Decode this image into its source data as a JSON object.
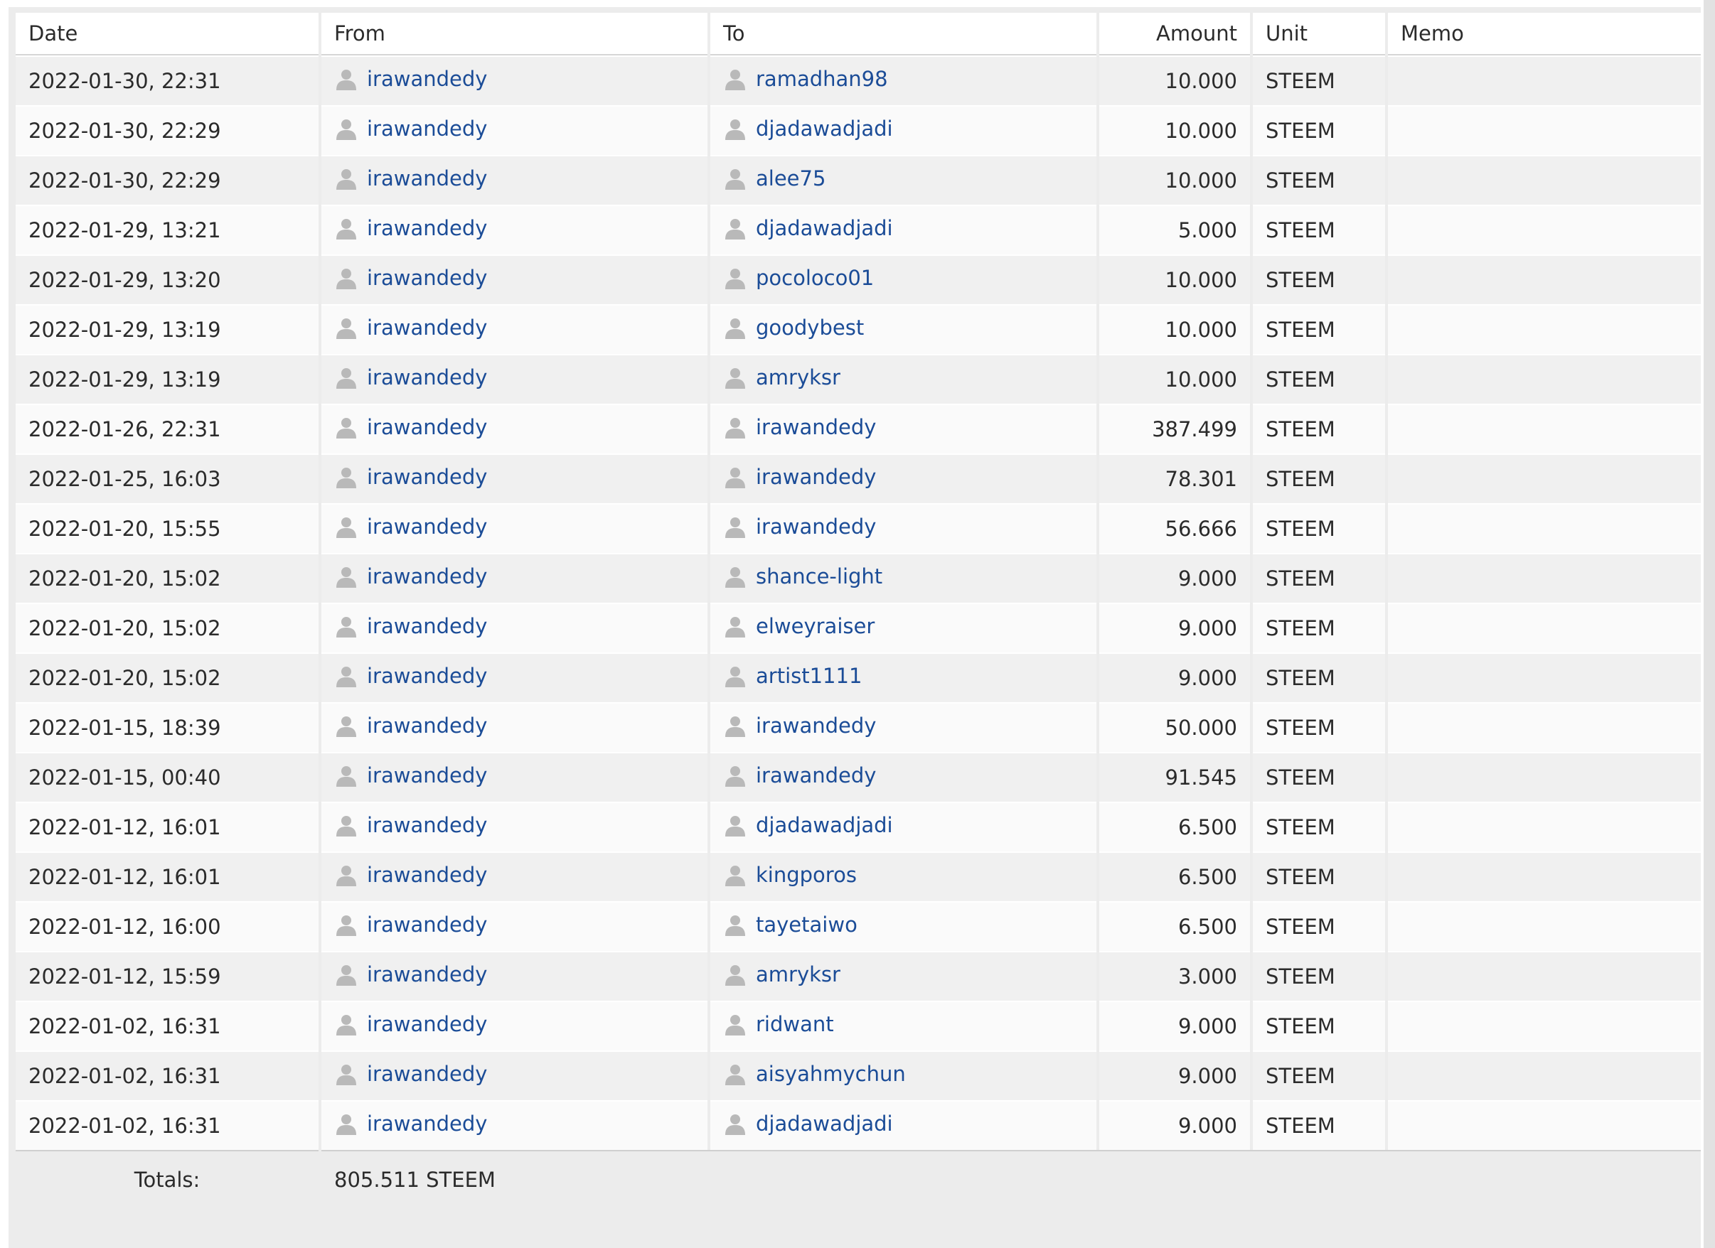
{
  "table": {
    "headers": {
      "date": "Date",
      "from": "From",
      "to": "To",
      "amount": "Amount",
      "unit": "Unit",
      "memo": "Memo"
    },
    "rows": [
      {
        "date": "2022-01-30, 22:31",
        "from": "irawandedy",
        "to": "ramadhan98",
        "amount": "10.000",
        "unit": "STEEM",
        "memo": ""
      },
      {
        "date": "2022-01-30, 22:29",
        "from": "irawandedy",
        "to": "djadawadjadi",
        "amount": "10.000",
        "unit": "STEEM",
        "memo": ""
      },
      {
        "date": "2022-01-30, 22:29",
        "from": "irawandedy",
        "to": "alee75",
        "amount": "10.000",
        "unit": "STEEM",
        "memo": ""
      },
      {
        "date": "2022-01-29, 13:21",
        "from": "irawandedy",
        "to": "djadawadjadi",
        "amount": "5.000",
        "unit": "STEEM",
        "memo": ""
      },
      {
        "date": "2022-01-29, 13:20",
        "from": "irawandedy",
        "to": "pocoloco01",
        "amount": "10.000",
        "unit": "STEEM",
        "memo": ""
      },
      {
        "date": "2022-01-29, 13:19",
        "from": "irawandedy",
        "to": "goodybest",
        "amount": "10.000",
        "unit": "STEEM",
        "memo": ""
      },
      {
        "date": "2022-01-29, 13:19",
        "from": "irawandedy",
        "to": "amryksr",
        "amount": "10.000",
        "unit": "STEEM",
        "memo": ""
      },
      {
        "date": "2022-01-26, 22:31",
        "from": "irawandedy",
        "to": "irawandedy",
        "amount": "387.499",
        "unit": "STEEM",
        "memo": ""
      },
      {
        "date": "2022-01-25, 16:03",
        "from": "irawandedy",
        "to": "irawandedy",
        "amount": "78.301",
        "unit": "STEEM",
        "memo": ""
      },
      {
        "date": "2022-01-20, 15:55",
        "from": "irawandedy",
        "to": "irawandedy",
        "amount": "56.666",
        "unit": "STEEM",
        "memo": ""
      },
      {
        "date": "2022-01-20, 15:02",
        "from": "irawandedy",
        "to": "shance-light",
        "amount": "9.000",
        "unit": "STEEM",
        "memo": ""
      },
      {
        "date": "2022-01-20, 15:02",
        "from": "irawandedy",
        "to": "elweyraiser",
        "amount": "9.000",
        "unit": "STEEM",
        "memo": ""
      },
      {
        "date": "2022-01-20, 15:02",
        "from": "irawandedy",
        "to": "artist1111",
        "amount": "9.000",
        "unit": "STEEM",
        "memo": ""
      },
      {
        "date": "2022-01-15, 18:39",
        "from": "irawandedy",
        "to": "irawandedy",
        "amount": "50.000",
        "unit": "STEEM",
        "memo": ""
      },
      {
        "date": "2022-01-15, 00:40",
        "from": "irawandedy",
        "to": "irawandedy",
        "amount": "91.545",
        "unit": "STEEM",
        "memo": ""
      },
      {
        "date": "2022-01-12, 16:01",
        "from": "irawandedy",
        "to": "djadawadjadi",
        "amount": "6.500",
        "unit": "STEEM",
        "memo": ""
      },
      {
        "date": "2022-01-12, 16:01",
        "from": "irawandedy",
        "to": "kingporos",
        "amount": "6.500",
        "unit": "STEEM",
        "memo": ""
      },
      {
        "date": "2022-01-12, 16:00",
        "from": "irawandedy",
        "to": "tayetaiwo",
        "amount": "6.500",
        "unit": "STEEM",
        "memo": ""
      },
      {
        "date": "2022-01-12, 15:59",
        "from": "irawandedy",
        "to": "amryksr",
        "amount": "3.000",
        "unit": "STEEM",
        "memo": ""
      },
      {
        "date": "2022-01-02, 16:31",
        "from": "irawandedy",
        "to": "ridwant",
        "amount": "9.000",
        "unit": "STEEM",
        "memo": ""
      },
      {
        "date": "2022-01-02, 16:31",
        "from": "irawandedy",
        "to": "aisyahmychun",
        "amount": "9.000",
        "unit": "STEEM",
        "memo": ""
      },
      {
        "date": "2022-01-02, 16:31",
        "from": "irawandedy",
        "to": "djadawadjadi",
        "amount": "9.000",
        "unit": "STEEM",
        "memo": ""
      }
    ],
    "totals": {
      "label": "Totals:",
      "value": "805.511 STEEM"
    }
  },
  "icons": {
    "user": "user-silhouette-icon"
  },
  "colors": {
    "link": "#1b4c97",
    "icon": "#b9b9b9",
    "row_odd": "#f0f0f0",
    "row_even": "#fafafa"
  }
}
